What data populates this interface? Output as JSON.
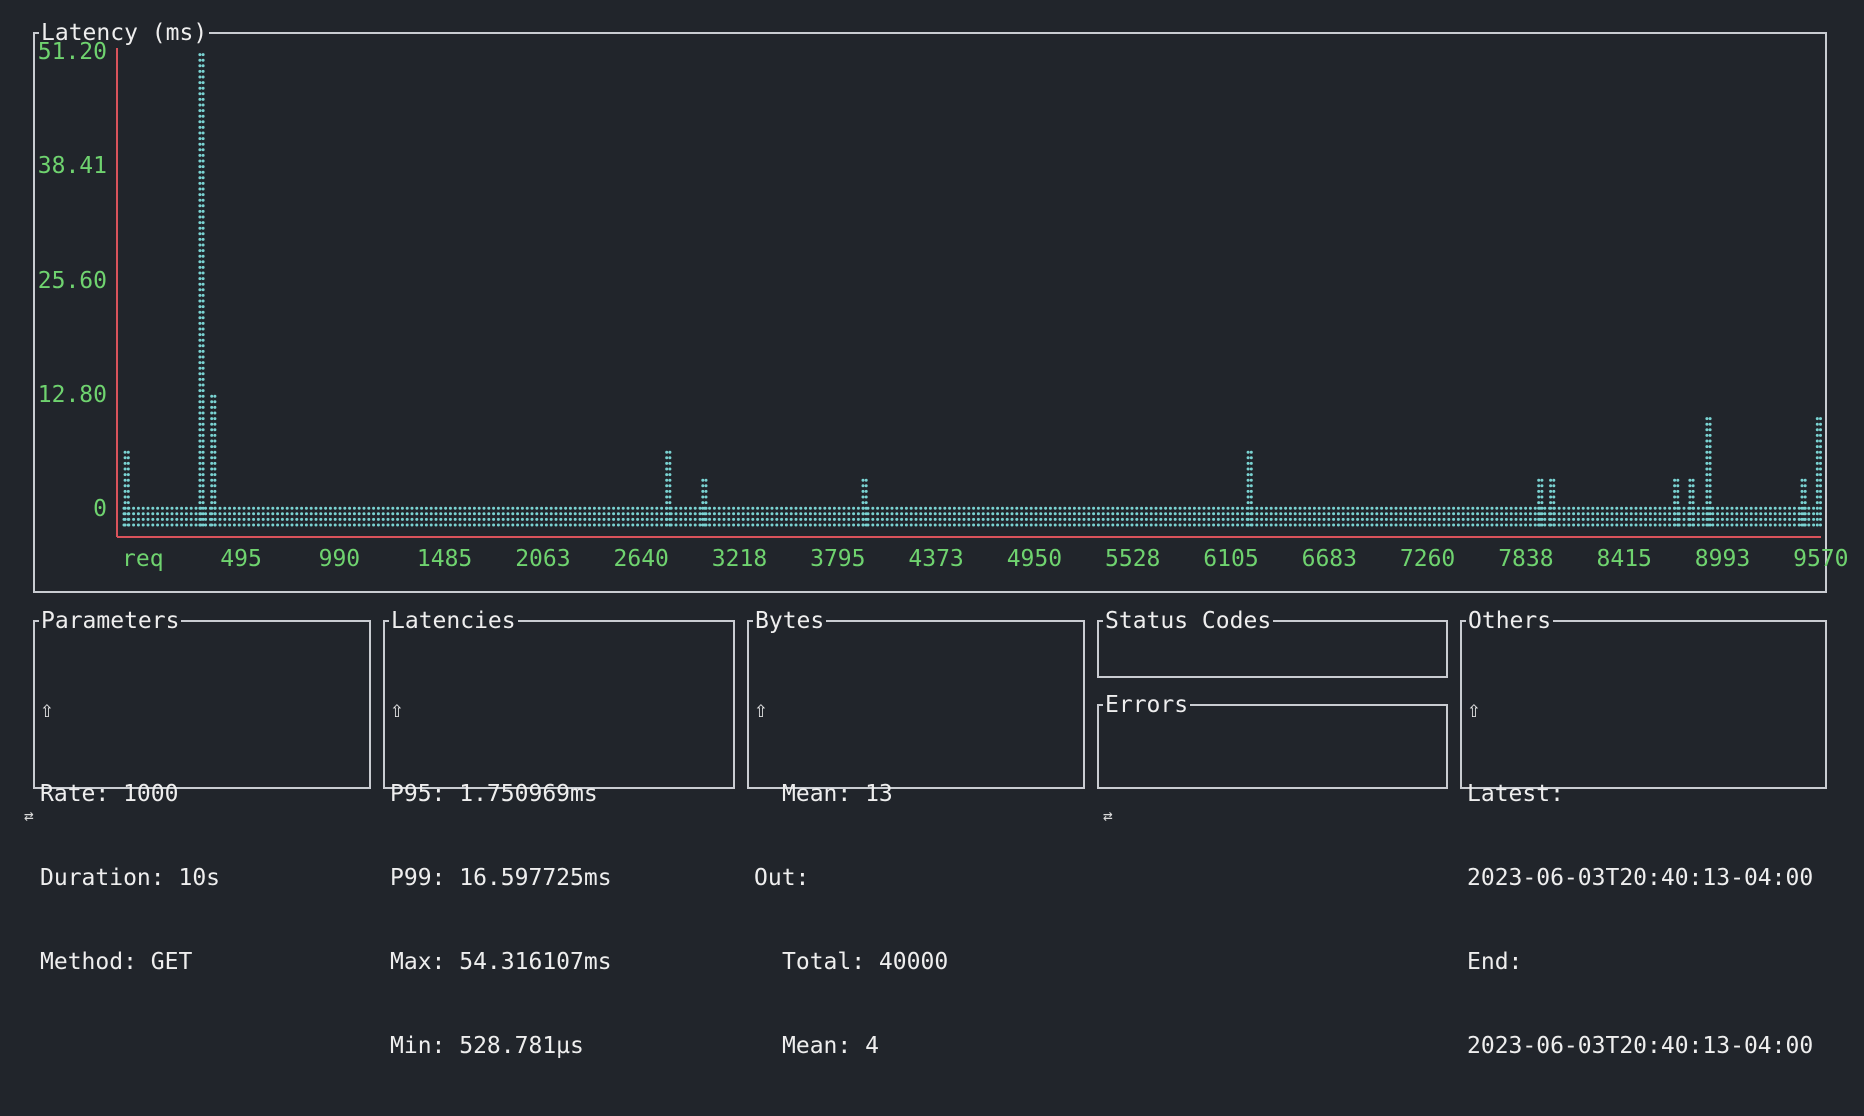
{
  "colors": {
    "background": "#21252b",
    "border": "#c9ccd1",
    "axis": "#d9535b",
    "tick_label": "#6fd36f",
    "marker": "#7ad3d2",
    "text": "#eeeeee"
  },
  "latency_panel": {
    "title": "Latency (ms)"
  },
  "chart_data": {
    "type": "scatter",
    "marker": "braille-dot",
    "title": "Latency (ms)",
    "xlabel": "",
    "ylabel": "",
    "ylim": [
      0,
      51.2
    ],
    "xlim": [
      0,
      10000
    ],
    "y_ticks": [
      "51.20",
      "38.41",
      "25.60",
      "12.80",
      "0"
    ],
    "y_tick_values": [
      51.2,
      38.41,
      25.6,
      12.8,
      0
    ],
    "x_ticks": [
      "req",
      "495",
      "990",
      "1485",
      "2063",
      "2640",
      "3218",
      "3795",
      "4373",
      "4950",
      "5528",
      "6105",
      "6683",
      "7260",
      "7838",
      "8415",
      "8993",
      "9570"
    ],
    "x_tick_values": [
      0,
      495,
      990,
      1485,
      2063,
      2640,
      3218,
      3795,
      4373,
      4950,
      5528,
      6105,
      6683,
      7260,
      7838,
      8415,
      8993,
      9570
    ],
    "baseline_latency": 0.7,
    "spikes": [
      {
        "x": 30,
        "y": 6.8
      },
      {
        "x": 470,
        "y": 51.2
      },
      {
        "x": 540,
        "y": 13.2
      },
      {
        "x": 3218,
        "y": 6.8
      },
      {
        "x": 3430,
        "y": 3.8
      },
      {
        "x": 4373,
        "y": 3.8
      },
      {
        "x": 6640,
        "y": 6.8
      },
      {
        "x": 8350,
        "y": 3.8
      },
      {
        "x": 8420,
        "y": 3.8
      },
      {
        "x": 9150,
        "y": 3.8
      },
      {
        "x": 9240,
        "y": 3.8
      },
      {
        "x": 9340,
        "y": 10.4
      },
      {
        "x": 9900,
        "y": 3.8
      },
      {
        "x": 9990,
        "y": 10.4
      }
    ]
  },
  "parameters": {
    "title": "Parameters",
    "arrow": "⇧",
    "lines": [
      "Rate: 1000",
      "Duration: 10s",
      "Method: GET"
    ]
  },
  "latencies": {
    "title": "Latencies",
    "arrow": "⇧",
    "lines": [
      "P95: 1.750969ms",
      "P99: 16.597725ms",
      "Max: 54.316107ms",
      "Min: 528.781µs"
    ]
  },
  "bytes": {
    "title": "Bytes",
    "arrow": "⇧",
    "in_mean": "Mean: 13",
    "out_label": "Out:",
    "out_total": "Total: 40000",
    "out_mean": "Mean: 4"
  },
  "status_codes": {
    "title": "Status Codes"
  },
  "errors": {
    "title": "Errors"
  },
  "others": {
    "title": "Others",
    "arrow": "⇧",
    "lines": [
      "Latest:",
      "2023-06-03T20:40:13-04:00",
      "End:",
      "2023-06-03T20:40:13-04:00"
    ]
  },
  "footer": {
    "left_icon": "⇄",
    "right_icon": "⇄"
  }
}
